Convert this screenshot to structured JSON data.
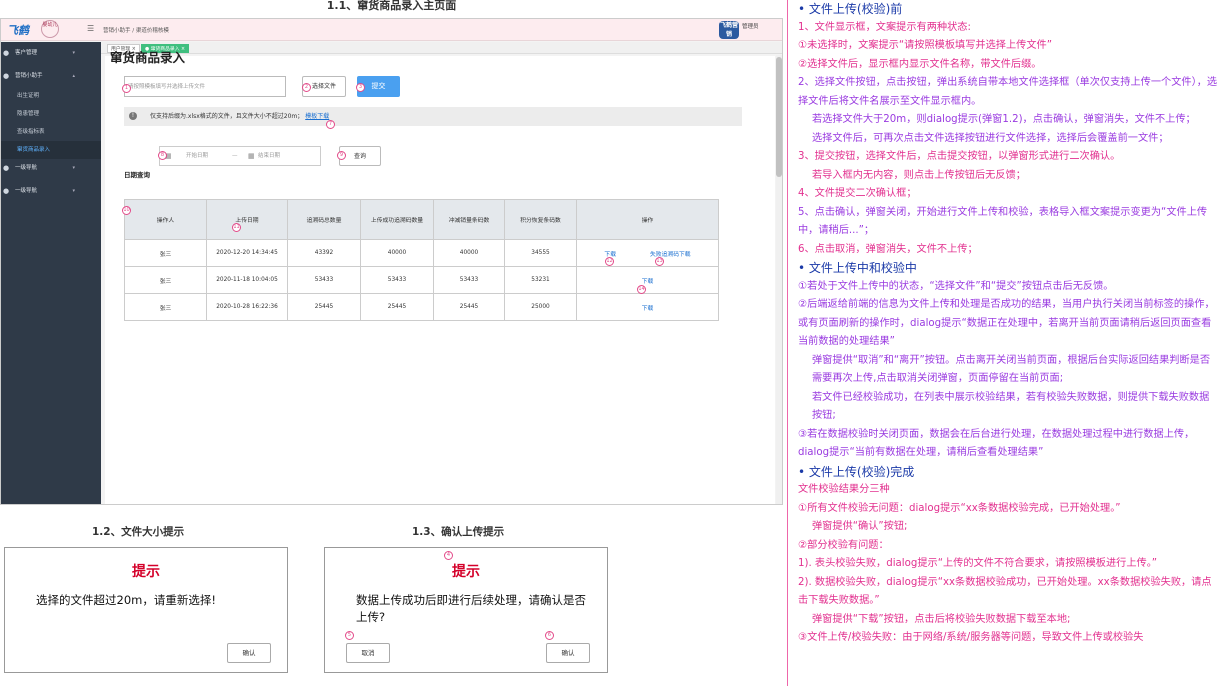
{
  "main_section_title": "1.1、窜货商品录入主页面",
  "topbar": {
    "logo": "飞鹤",
    "logo2": "婴幼儿",
    "breadcrumb": "营销小助手 / 渠道价稽核模",
    "badge": "飞鹤营销",
    "user": "管理员"
  },
  "sidebar": {
    "items": [
      {
        "label": "客户管理",
        "icon": "user-icon"
      },
      {
        "label": "营销小助手",
        "icon": "user-icon"
      },
      {
        "label": "出生证明"
      },
      {
        "label": "隐患管理"
      },
      {
        "label": "查级指标表"
      },
      {
        "label": "窜货商品录入"
      },
      {
        "label": "一级导航",
        "icon": "user-icon"
      },
      {
        "label": "一级导航",
        "icon": "user-icon"
      }
    ]
  },
  "tabs": [
    "用户管理 ×",
    "● 窜货商品录入 ×"
  ],
  "page": {
    "title": "窜货商品录入",
    "file_placeholder": "请按照模板填写并选择上传文件",
    "select_label": "选择文件",
    "submit_label": "提交",
    "info_text": "仅支持后缀为.xlsx格式的文件，且文件大小不超过20m；",
    "template_link": "模板下载",
    "date_label": "日期查询",
    "date_start": "开始日期",
    "date_sep": "—",
    "date_end": "结束日期",
    "query_label": "查询"
  },
  "table": {
    "headers": [
      "操作人",
      "上传日期",
      "追溯码总数量",
      "上传成功追溯码数量",
      "冲减销量条码数",
      "积分恢复条码数",
      "操作"
    ],
    "rows": [
      {
        "user": "张三",
        "date": "2020-12-20 14:34:45",
        "total": "43392",
        "success": "40000",
        "reduce": "40000",
        "points": "34555",
        "actions": [
          "下载",
          "失败追溯码下载"
        ]
      },
      {
        "user": "张三",
        "date": "2020-11-18 10:04:05",
        "total": "53433",
        "success": "53433",
        "reduce": "53433",
        "points": "53231",
        "actions": [
          "下载"
        ]
      },
      {
        "user": "张三",
        "date": "2020-10-28 16:22:36",
        "total": "25445",
        "success": "25445",
        "reduce": "25445",
        "points": "25000",
        "actions": [
          "下载"
        ]
      }
    ]
  },
  "badges": [
    "1",
    "2",
    "3",
    "7",
    "8",
    "9",
    "10",
    "11",
    "12",
    "13",
    "14"
  ],
  "dialogs": {
    "size": {
      "section": "1.2、文件大小提示",
      "title": "提示",
      "msg": "选择的文件超过20m，请重新选择!",
      "ok": "确认"
    },
    "confirm": {
      "section": "1.3、确认上传提示",
      "title": "提示",
      "msg": "数据上传成功后即进行后续处理，请确认是否上传?",
      "cancel": "取消",
      "ok": "确认",
      "badges": [
        "4",
        "5",
        "6"
      ]
    }
  },
  "notes": [
    {
      "cls": "h",
      "text": "• 文件上传(校验)前"
    },
    {
      "cls": "",
      "text": "1、文件显示框，文案提示有两种状态:"
    },
    {
      "cls": "",
      "text": "①未选择时，文案提示“请按照模板填写并选择上传文件”"
    },
    {
      "cls": "",
      "text": "②选择文件后，显示框内显示文件名称，带文件后缀。"
    },
    {
      "cls": "p",
      "text": "2、选择文件按钮，点击按钮，弹出系统自带本地文件选择框（单次仅支持上传一个文件），选择文件后将文件名展示至文件显示框内。"
    },
    {
      "cls": "p ind",
      "text": "若选择文件大于20m，则dialog提示(弹窗1.2)，点击确认，弹窗消失，文件不上传；"
    },
    {
      "cls": "p ind",
      "text": "选择文件后，可再次点击文件选择按钮进行文件选择，选择后会覆盖前一文件；"
    },
    {
      "cls": "",
      "text": "3、提交按钮，选择文件后，点击提交按钮，以弹窗形式进行二次确认。"
    },
    {
      "cls": " ind",
      "text": "若导入框内无内容，则点击上传按钮后无反馈；"
    },
    {
      "cls": "",
      "text": "4、文件提交二次确认框；"
    },
    {
      "cls": "p",
      "text": "5、点击确认，弹窗关闭，开始进行文件上传和校验，表格导入框文案提示变更为“文件上传中，请稍后...”；"
    },
    {
      "cls": "",
      "text": "6、点击取消，弹窗消失，文件不上传；"
    },
    {
      "cls": "h",
      "text": "• 文件上传中和校验中"
    },
    {
      "cls": "p",
      "text": "①若处于文件上传中的状态，“选择文件”和“提交”按钮点击后无反馈。"
    },
    {
      "cls": "p",
      "text": "②后端返给前端的信息为文件上传和处理是否成功的结果，当用户执行关闭当前标签的操作，或有页面刷新的操作时，dialog提示“数据正在处理中，若离开当前页面请稍后返回页面查看当前数据的处理结果”"
    },
    {
      "cls": "p ind",
      "text": "弹窗提供“取消”和“离开”按钮。点击离开关闭当前页面，根据后台实际返回结果判断是否需要再次上传,点击取消关闭弹窗，页面停留在当前页面;"
    },
    {
      "cls": "p ind",
      "text": "若文件已经校验成功，在列表中展示校验结果，若有校验失败数据，则提供下载失败数据按钮;"
    },
    {
      "cls": "p",
      "text": "③若在数据校验时关闭页面，数据会在后台进行处理，在数据处理过程中进行数据上传，dialog提示“当前有数据在处理，请稍后查看处理结果”"
    },
    {
      "cls": "h",
      "text": "• 文件上传(校验)完成"
    },
    {
      "cls": "",
      "text": "文件校验结果分三种"
    },
    {
      "cls": "",
      "text": "①所有文件校验无问题：dialog提示“xx条数据校验完成，已开始处理。”"
    },
    {
      "cls": " ind",
      "text": "弹窗提供“确认”按钮;"
    },
    {
      "cls": "",
      "text": "②部分校验有问题："
    },
    {
      "cls": "",
      "text": "1). 表头校验失败，dialog提示“上传的文件不符合要求，请按照模板进行上传。”"
    },
    {
      "cls": "",
      "text": "2). 数据校验失败，dialog提示“xx条数据校验成功，已开始处理。xx条数据校验失败，请点击下载失败数据。”"
    },
    {
      "cls": " ind",
      "text": "弹窗提供“下载”按钮，点击后将校验失败数据下载至本地;"
    },
    {
      "cls": "",
      "text": "③文件上传/校验失败：由于网络/系统/服务器等问题，导致文件上传或校验失"
    }
  ]
}
